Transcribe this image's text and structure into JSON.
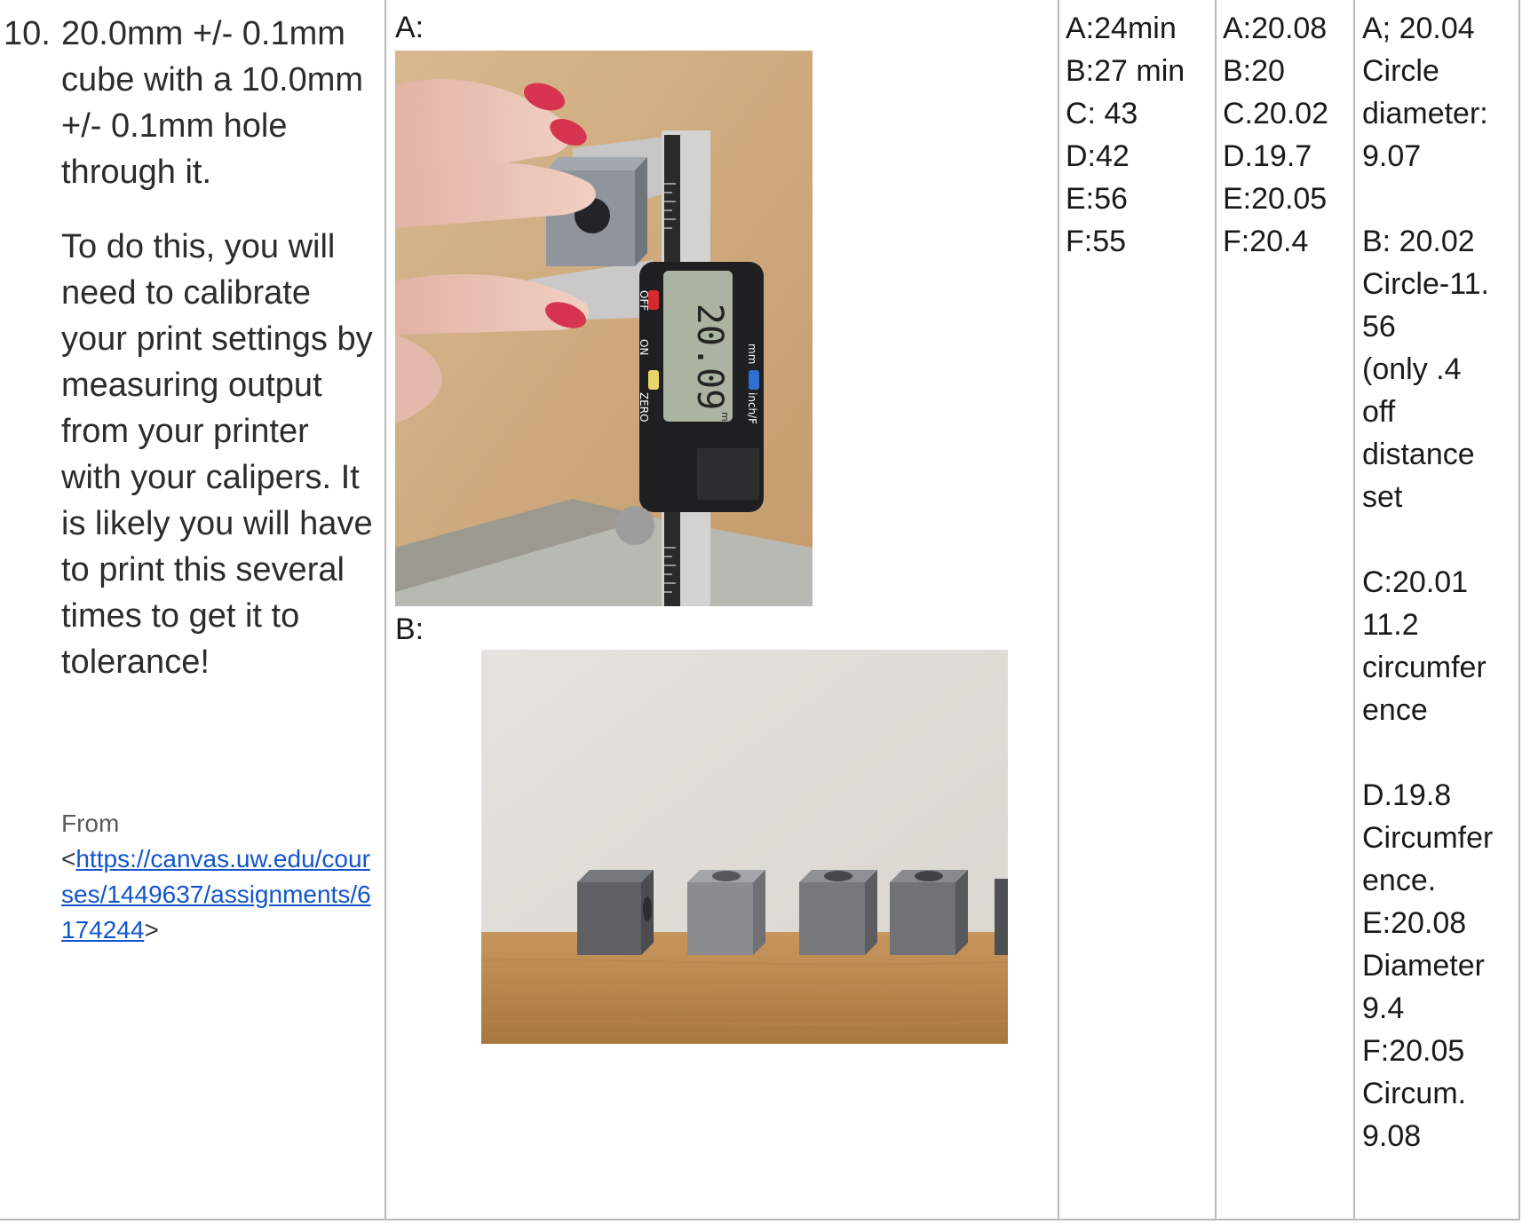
{
  "task": {
    "number": "10.",
    "title": "20.0mm +/- 0.1mm cube with a 10.0mm +/- 0.1mm hole through it.",
    "instructions": "To do this, you will need to calibrate your print settings by measuring output from your printer with your calipers. It is likely you will have to print this several times to get it to tolerance!",
    "source_from": "From",
    "source_open": "<",
    "source_url": "https://canvas.uw.edu/courses/1449637/assignments/6174244",
    "source_close": ">"
  },
  "photos": {
    "a_label": "A:",
    "b_label": "B:",
    "caliper_reading": "20.09",
    "caliper_unit": "mm",
    "caliper_off": "OFF",
    "caliper_on": "ON",
    "caliper_zero": "ZERO",
    "caliper_inch": "inch/F",
    "caliper_mm": "mm"
  },
  "times": [
    "A:24min",
    "B:27 min",
    "C: 43",
    "D:42",
    "E:56",
    "F:55"
  ],
  "sizes": [
    "A:20.08",
    "B:20",
    "C.20.02",
    "D.19.7",
    "E:20.05",
    "F:20.4"
  ],
  "notes": [
    "A; 20.04",
    "Circle",
    "diameter:",
    "9.07",
    "",
    "B: 20.02",
    "Circle-11.",
    "56",
    "(only .4",
    "off",
    "distance",
    "set",
    "",
    "C:20.01",
    "11.2",
    "circumfer",
    "ence",
    "",
    "D.19.8",
    "Circumfer",
    "ence.",
    "E:20.08",
    "Diameter",
    "9.4",
    "F:20.05",
    "Circum.",
    "9.08"
  ],
  "colors": {
    "border": "#b9b9b9",
    "text": "#1a1a1a",
    "link": "#1155cc",
    "nail": "#d7354f"
  }
}
